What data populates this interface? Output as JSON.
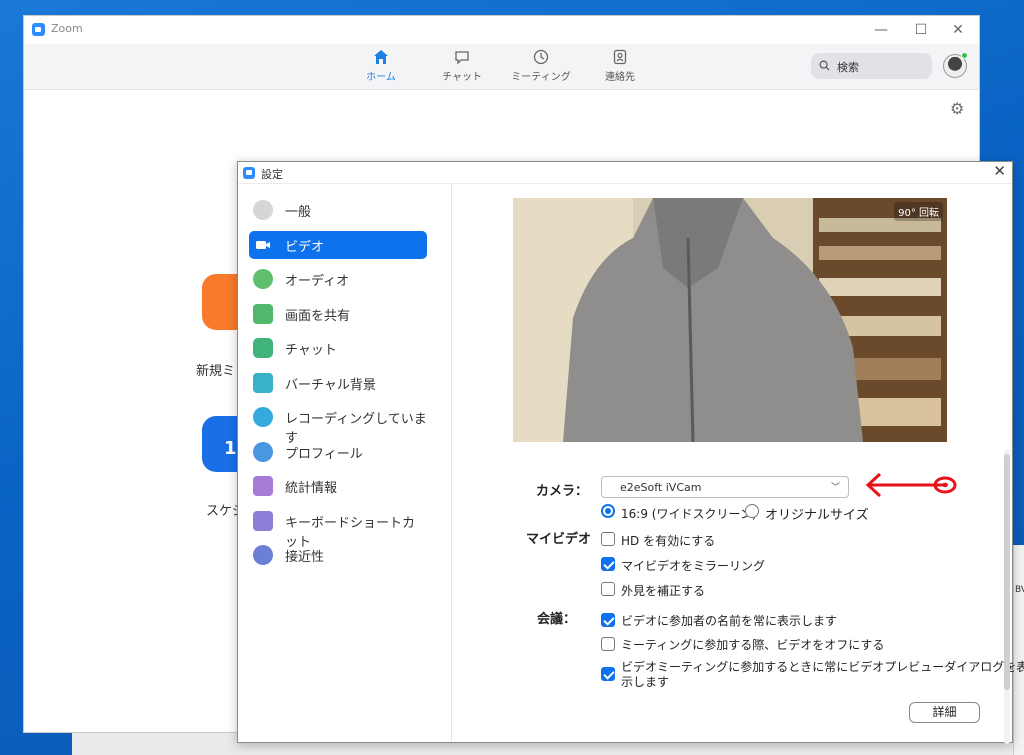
{
  "colors": {
    "accent": "#0e72ed",
    "zoom_blue": "#2d8cff",
    "annotation_red": "#e8131a"
  },
  "zoom_main": {
    "title": "Zoom",
    "window_controls": {
      "minimize": "—",
      "maximize": "☐",
      "close": "✕"
    },
    "nav": [
      {
        "label": "ホーム",
        "icon": "home-icon",
        "active": true
      },
      {
        "label": "チャット",
        "icon": "chat-bubble-icon",
        "active": false
      },
      {
        "label": "ミーティング",
        "icon": "clock-icon",
        "active": false
      },
      {
        "label": "連絡先",
        "icon": "contacts-icon",
        "active": false
      }
    ],
    "search": {
      "placeholder": "検索"
    },
    "home_labels": {
      "new_meeting": "新規ミ",
      "schedule": "スケジ"
    }
  },
  "settings": {
    "title": "設定",
    "close": "✕",
    "sidebar": [
      {
        "label": "一般",
        "icon": "gear-icon",
        "color": "#d6d6d6"
      },
      {
        "label": "ビデオ",
        "icon": "video-camera-icon",
        "color": "#0e72ed",
        "active": true
      },
      {
        "label": "オーディオ",
        "icon": "headphones-icon",
        "color": "#5fbf6e"
      },
      {
        "label": "画面を共有",
        "icon": "share-screen-icon",
        "color": "#4fb86a"
      },
      {
        "label": "チャット",
        "icon": "chat-icon",
        "color": "#3fb37a"
      },
      {
        "label": "バーチャル背景",
        "icon": "virtual-background-icon",
        "color": "#39b2c8"
      },
      {
        "label": "レコーディングしています",
        "icon": "record-icon",
        "color": "#34a9dd"
      },
      {
        "label": "プロフィール",
        "icon": "profile-icon",
        "color": "#4b96e0"
      },
      {
        "label": "統計情報",
        "icon": "statistics-icon",
        "color": "#a77bd8"
      },
      {
        "label": "キーボードショートカット",
        "icon": "keyboard-icon",
        "color": "#8d7fd8"
      },
      {
        "label": "接近性",
        "icon": "accessibility-icon",
        "color": "#6b7fd6"
      }
    ],
    "video": {
      "rotate_label": "90° 回転",
      "camera_label": "カメラ：",
      "camera_value": "e2eSoft iVCam",
      "aspect_options": [
        {
          "label": "16:9 (ワイドスクリーン)",
          "selected": true
        },
        {
          "label": "オリジナルサイズ",
          "selected": false
        }
      ],
      "my_video_label": "マイビデオ",
      "my_video_options": [
        {
          "label": "HD を有効にする",
          "checked": false
        },
        {
          "label": "マイビデオをミラーリング",
          "checked": true
        },
        {
          "label": "外見を補正する",
          "checked": false
        }
      ],
      "meeting_label": "会議：",
      "meeting_options": [
        {
          "label": "ビデオに参加者の名前を常に表示します",
          "checked": true
        },
        {
          "label": "ミーティングに参加する際、ビデオをオフにする",
          "checked": false
        },
        {
          "label": "ビデオミーティングに参加するときに常にビデオプレビューダイアログを表",
          "label2": "示します",
          "checked": true
        }
      ],
      "detail_button": "詳細"
    }
  },
  "desktop": {
    "right_edge_text": "BV"
  }
}
